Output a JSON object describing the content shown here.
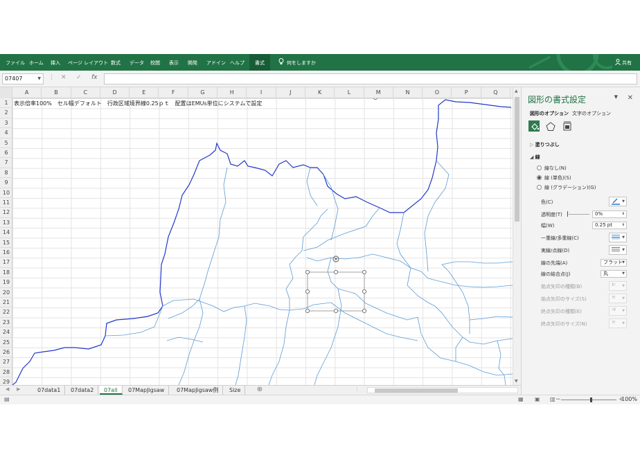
{
  "ribbon": {
    "tabs": [
      "ファイル",
      "ホーム",
      "挿入",
      "ページ レイアウト",
      "数式",
      "データ",
      "校閲",
      "表示",
      "開発",
      "アドイン",
      "ヘルプ",
      "書式"
    ],
    "active_tab": "書式",
    "tell_me": "何をしますか",
    "share": "共有",
    "color": "#217346"
  },
  "formula_bar": {
    "name_box": "07407",
    "fx": "fx",
    "formula": ""
  },
  "grid": {
    "columns": [
      "A",
      "B",
      "C",
      "D",
      "E",
      "F",
      "G",
      "H",
      "I",
      "J",
      "K",
      "L",
      "M",
      "N",
      "O",
      "P",
      "Q"
    ],
    "rows": [
      "1",
      "2",
      "3",
      "4",
      "5",
      "6",
      "7",
      "8",
      "9",
      "10",
      "11",
      "12",
      "13",
      "14",
      "15",
      "16",
      "17",
      "18",
      "19",
      "20",
      "21",
      "22",
      "23",
      "24",
      "25",
      "26",
      "27",
      "28",
      "29"
    ],
    "a1_text": "表示倍率100%　セル幅デフォルト　行政区域境界線0.25ｐｔ　配置はEMUs単位にシステムで設定"
  },
  "sheet_tabs": {
    "tabs": [
      "07data1",
      "07data2",
      "07all",
      "07MapJigsaw",
      "07MapJigsaw例",
      "Size"
    ],
    "active": "07all"
  },
  "status_bar": {
    "zoom": "100%"
  },
  "format_pane": {
    "title": "図形の書式設定",
    "tab_shape": "図形のオプション",
    "tab_text": "文字のオプション",
    "fill_section": "塗りつぶし",
    "line_section": "線",
    "radio_none": "線なし(N)",
    "radio_solid": "線 (単色)(S)",
    "radio_gradient": "線 (グラデーション)(G)",
    "color_label": "色(C)",
    "transparency_label": "透明度(T)",
    "transparency_value": "0%",
    "width_label": "幅(W)",
    "width_value": "0.25 pt",
    "compound_label": "一重線/多重線(C)",
    "dash_label": "実線/点線(D)",
    "cap_label": "線の先端(A)",
    "cap_value": "フラット",
    "join_label": "線の結合点(J)",
    "join_value": "丸",
    "begin_arrow_type": "始点矢印の種類(B)",
    "begin_arrow_size": "始点矢印のサイズ(S)",
    "end_arrow_type": "終点矢印の種類(E)",
    "end_arrow_size": "終点矢印のサイズ(N)",
    "accent_color": "#217346",
    "line_color": "#5b9bd5"
  }
}
